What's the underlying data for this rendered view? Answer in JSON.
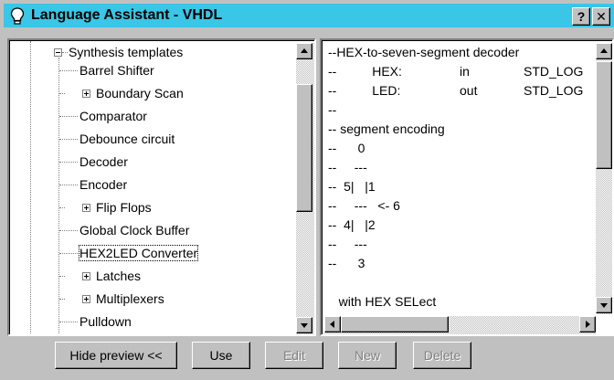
{
  "window": {
    "title": "Language Assistant - VHDL",
    "help_label": "?",
    "close_label": "✕",
    "colors": {
      "titlebar": "#3ac6e6",
      "face": "#c0c0c0"
    },
    "icon": "lightbulb-icon"
  },
  "tree": {
    "root_label": "Synthesis templates",
    "items": [
      {
        "label": "Barrel Shifter",
        "expandable": false
      },
      {
        "label": "Boundary Scan",
        "expandable": true
      },
      {
        "label": "Comparator",
        "expandable": false
      },
      {
        "label": "Debounce circuit",
        "expandable": false
      },
      {
        "label": "Decoder",
        "expandable": false
      },
      {
        "label": "Encoder",
        "expandable": false
      },
      {
        "label": "Flip Flops",
        "expandable": true
      },
      {
        "label": "Global Clock Buffer",
        "expandable": false
      },
      {
        "label": "HEX2LED Converter",
        "expandable": false,
        "selected": true
      },
      {
        "label": "Latches",
        "expandable": true
      },
      {
        "label": "Multiplexers",
        "expandable": true
      },
      {
        "label": "Pulldown",
        "expandable": false
      }
    ]
  },
  "code": {
    "lines": [
      {
        "text": "--HEX-to-seven-segment decoder",
        "c2": "",
        "c3": ""
      },
      {
        "text": "--          HEX:",
        "c2": "in",
        "c3": "STD_LOG"
      },
      {
        "text": "--          LED:",
        "c2": "out",
        "c3": "STD_LOG"
      },
      {
        "text": "--",
        "c2": "",
        "c3": ""
      },
      {
        "text": "-- segment encoding",
        "c2": "",
        "c3": ""
      },
      {
        "text": "--      0",
        "c2": "",
        "c3": ""
      },
      {
        "text": "--     ---",
        "c2": "",
        "c3": ""
      },
      {
        "text": "--  5|   |1",
        "c2": "",
        "c3": ""
      },
      {
        "text": "--     ---   <- 6",
        "c2": "",
        "c3": ""
      },
      {
        "text": "--  4|   |2",
        "c2": "",
        "c3": ""
      },
      {
        "text": "--     ---",
        "c2": "",
        "c3": ""
      },
      {
        "text": "--      3",
        "c2": "",
        "c3": ""
      },
      {
        "text": "",
        "c2": "",
        "c3": ""
      },
      {
        "text": "   with HEX SELect",
        "c2": "",
        "c3": ""
      }
    ]
  },
  "buttons": {
    "hide_preview": "Hide preview <<",
    "use": "Use",
    "edit": "Edit",
    "new": "New",
    "delete": "Delete"
  }
}
